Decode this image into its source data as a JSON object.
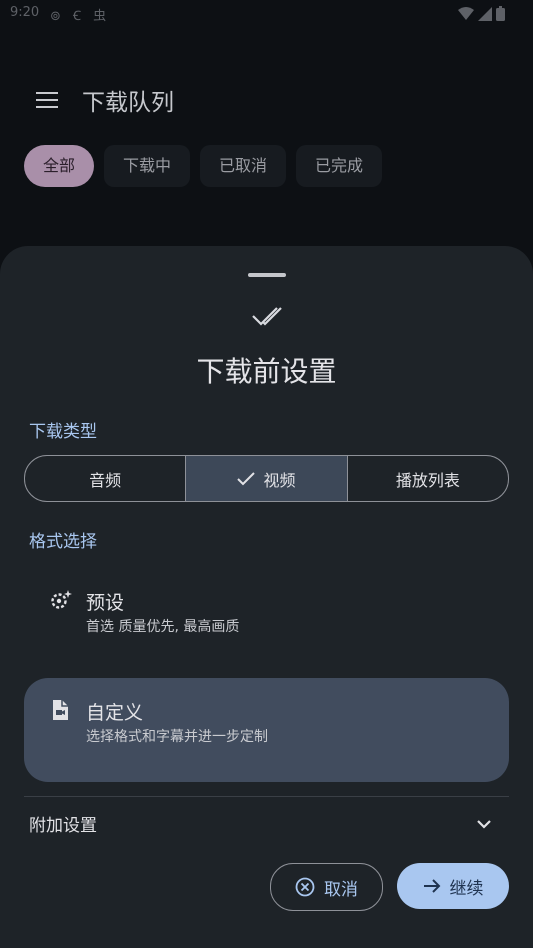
{
  "status_bar": {
    "time": "9:20",
    "icons_left": "⊚ Ꞓ 虫"
  },
  "app_bar": {
    "title": "下载队列"
  },
  "filters": [
    "全部",
    "下载中",
    "已取消",
    "已完成"
  ],
  "sheet": {
    "title": "下载前设置",
    "type_label": "下载类型",
    "types": [
      "音频",
      "视频",
      "播放列表"
    ],
    "format_label": "格式选择",
    "preset": {
      "title": "预设",
      "desc": "首选 质量优先, 最高画质"
    },
    "custom": {
      "title": "自定义",
      "desc": "选择格式和字幕并进一步定制"
    },
    "extra_label": "附加设置",
    "cancel": "取消",
    "continue": "继续"
  },
  "colors": {
    "accent": "#a9c7f0",
    "active_chip": "#a98fa9",
    "sheet": "#1e2328",
    "selected": "#414c5e"
  }
}
